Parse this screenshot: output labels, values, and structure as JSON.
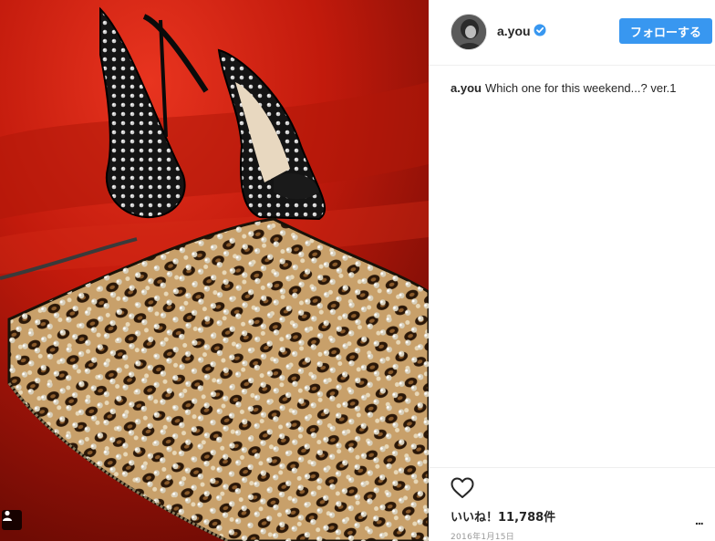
{
  "post": {
    "username": "a.you",
    "follow_label": "フォローする",
    "caption_user": "a.you",
    "caption_text": "Which one for this weekend...? ver.1",
    "likes_text": "いいね！11,788件",
    "date_text": "2016年1月15日",
    "more_label": "..."
  },
  "icons": {
    "verified": "verified-badge-icon",
    "heart": "heart-outline-icon",
    "user_tag": "person-icon",
    "more": "more-options-icon"
  },
  "colors": {
    "accent": "#3897f0",
    "text": "#262626",
    "muted": "#999999",
    "divider": "#efefef"
  }
}
